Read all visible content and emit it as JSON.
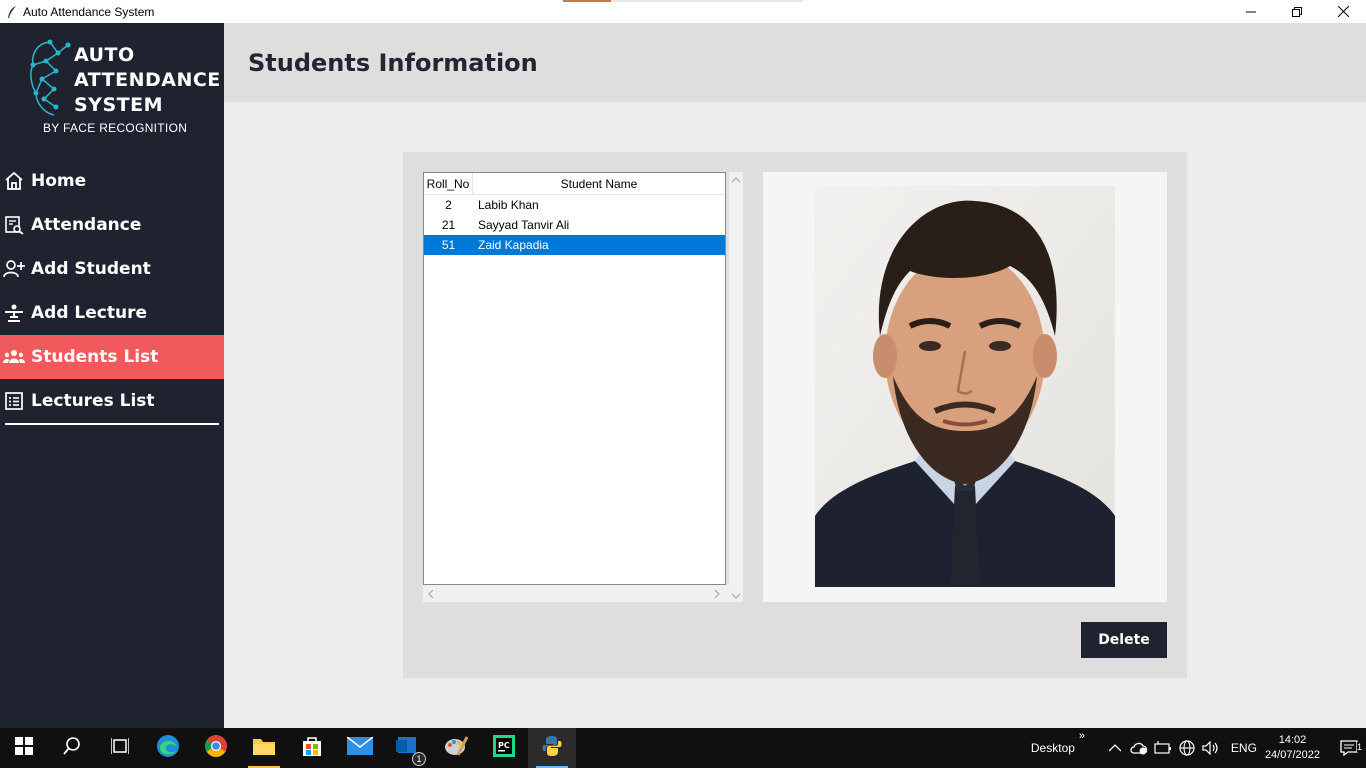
{
  "window": {
    "title": "Auto Attendance System"
  },
  "logo": {
    "line1": "AUTO",
    "line2": "ATTENDANCE",
    "line3": "SYSTEM",
    "subtitle": "BY FACE RECOGNITION"
  },
  "sidebar": {
    "items": [
      {
        "label": "Home",
        "icon": "home-icon",
        "active": false
      },
      {
        "label": "Attendance",
        "icon": "attendance-search-icon",
        "active": false
      },
      {
        "label": "Add Student",
        "icon": "add-user-icon",
        "active": false
      },
      {
        "label": "Add Lecture",
        "icon": "lecture-icon",
        "active": false
      },
      {
        "label": "Students List",
        "icon": "users-icon",
        "active": true
      },
      {
        "label": "Lectures List",
        "icon": "list-icon",
        "active": false
      }
    ]
  },
  "header": {
    "title": "Students Information"
  },
  "students_table": {
    "columns": [
      "Roll_No",
      "Student Name"
    ],
    "rows": [
      {
        "roll": "2",
        "name": "Labib Khan"
      },
      {
        "roll": "21",
        "name": "Sayyad Tanvir Ali"
      },
      {
        "roll": "51",
        "name": "Zaid Kapadia"
      }
    ],
    "selected_row": 2
  },
  "actions": {
    "delete_label": "Delete"
  },
  "taskbar": {
    "desktop_label": "Desktop",
    "chevron": "»",
    "language": "ENG",
    "time": "14:02",
    "date": "24/07/2022",
    "mail_badge": "1",
    "notification_badge": "1"
  },
  "colors": {
    "sidebar_bg": "#1f2330",
    "active_nav": "#f15a5c",
    "selection": "#0078d7"
  }
}
